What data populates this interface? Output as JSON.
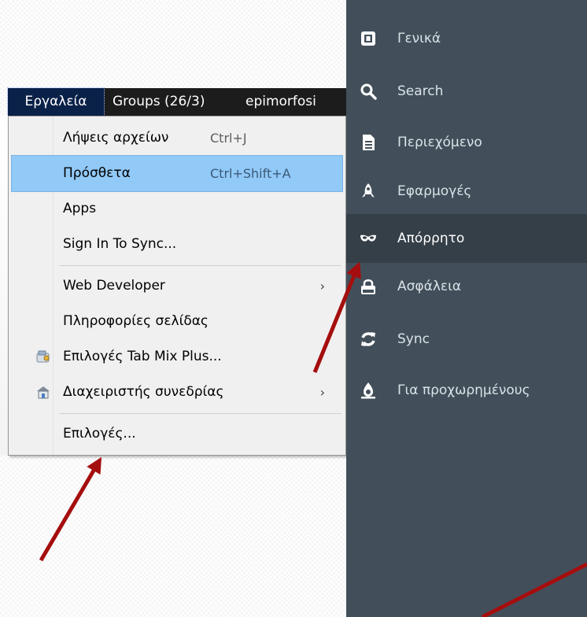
{
  "menubar": {
    "tools": "Εργαλεία",
    "groups": "Groups (26/3)",
    "profile": "epimorfosi"
  },
  "menu": {
    "items": [
      {
        "label": "Λήψεις αρχείων",
        "shortcut": "Ctrl+J"
      },
      {
        "label": "Πρόσθετα",
        "shortcut": "Ctrl+Shift+A"
      },
      {
        "label": "Apps"
      },
      {
        "label": "Sign In To Sync..."
      },
      {
        "label": "Web Developer",
        "submenu_arrow": "›"
      },
      {
        "label": "Πληροφορίες σελίδας"
      },
      {
        "label": "Επιλογές Tab Mix Plus...",
        "icon": "tabmix-icon"
      },
      {
        "label": "Διαχειριστής συνεδρίας",
        "icon": "session-manager-icon",
        "submenu_arrow": "›"
      },
      {
        "label": "Επιλογές..."
      }
    ],
    "highlighted_item": "Πρόσθετα"
  },
  "sidebar": {
    "selected": "Απόρρητο",
    "items": [
      {
        "label": "Γενικά",
        "icon": "general-icon"
      },
      {
        "label": "Search",
        "icon": "search-icon"
      },
      {
        "label": "Περιεχόμενο",
        "icon": "content-icon"
      },
      {
        "label": "Εφαρμογές",
        "icon": "applications-icon"
      },
      {
        "label": "Απόρρητο",
        "icon": "privacy-mask-icon"
      },
      {
        "label": "Ασφάλεια",
        "icon": "security-lock-icon"
      },
      {
        "label": "Sync",
        "icon": "sync-icon"
      },
      {
        "label": "Για προχωρημένους",
        "icon": "advanced-icon"
      }
    ]
  },
  "colors": {
    "sidebar_bg": "#424f5a",
    "sidebar_selected_bg": "#343f48",
    "menu_highlight": "#91c9f7",
    "arrow": "#a50e0e",
    "menubar_bg": "#1c1c1c"
  }
}
